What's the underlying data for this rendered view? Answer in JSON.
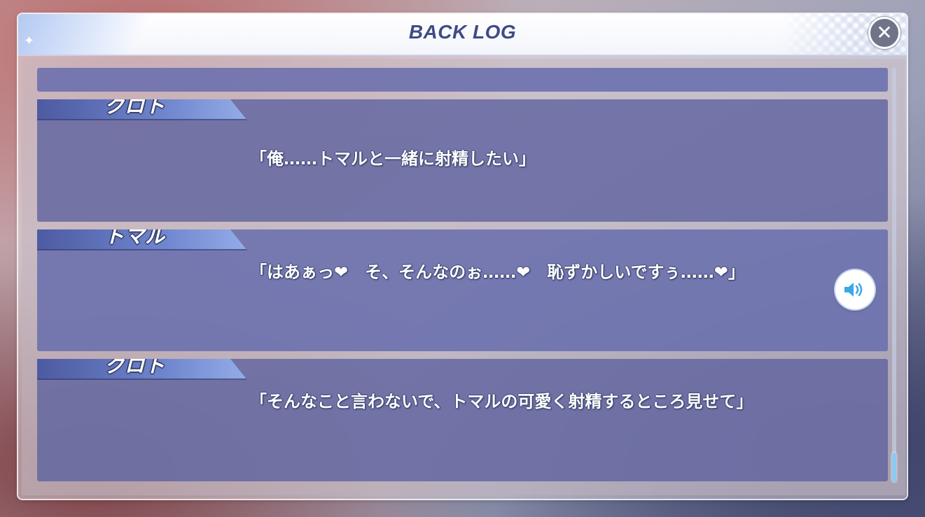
{
  "window": {
    "title": "BACK LOG",
    "close_icon": "close-icon"
  },
  "entries": [
    {
      "speaker": "",
      "text": ""
    },
    {
      "speaker": "クロト",
      "text": "「俺……トマルと一緒に射精したい」"
    },
    {
      "speaker": "トマル",
      "text": "「はあぁっ❤　そ、そんなのぉ……❤　恥ずかしいですぅ……❤」",
      "voice_icon": "speaker-volume-icon"
    },
    {
      "speaker": "クロト",
      "text": "「そんなこと言わないで、トマルの可愛く射精するところ見せて」"
    }
  ],
  "scrollbar": {
    "position": "bottom"
  },
  "colors": {
    "title": "#3e4c86",
    "entry_bg": "#60649f",
    "scroll_thumb": "#8ccaf0"
  }
}
